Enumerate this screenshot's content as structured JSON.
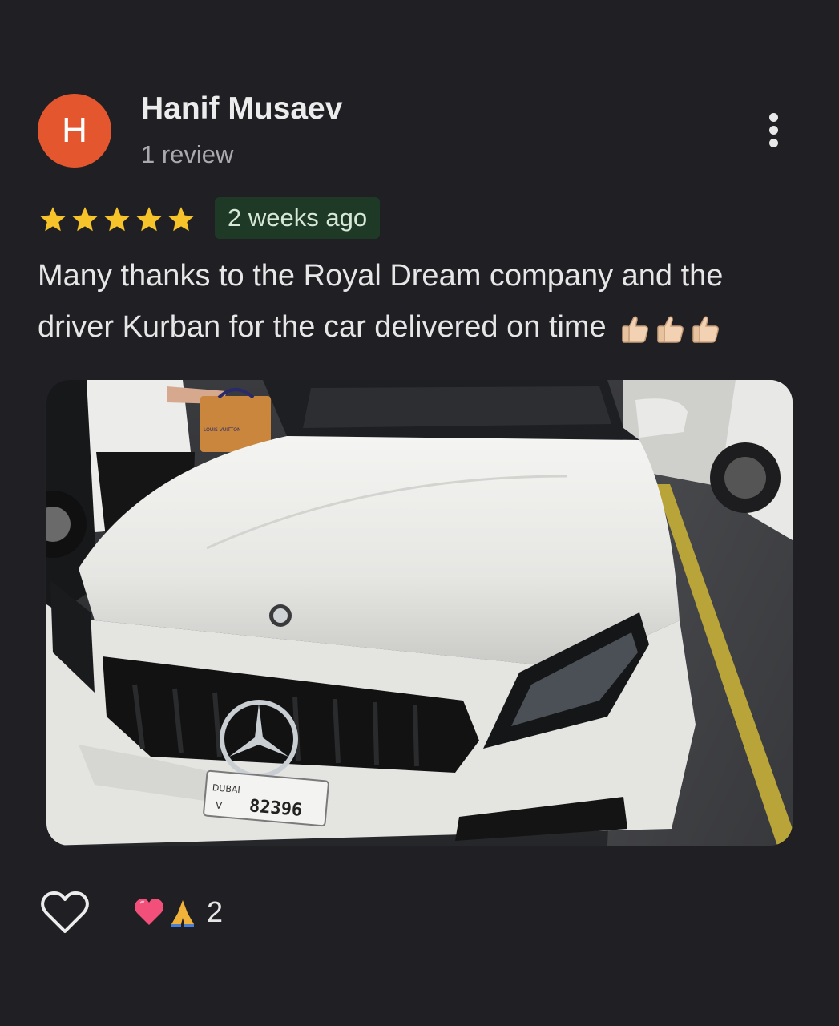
{
  "review": {
    "author_initial": "H",
    "author_name": "Hanif Musaev",
    "author_meta": "1 review",
    "rating": 5,
    "date": "2 weeks ago",
    "text": "Many thanks to the Royal Dream company and the driver Kurban for the car delivered on time",
    "text_emoji_icons": [
      "thumbs-up-icon",
      "thumbs-up-icon",
      "thumbs-up-icon"
    ],
    "photo": {
      "subject": "white-car-photo",
      "plate_number": "82396",
      "plate_letter": "V",
      "plate_city": "DUBAI",
      "bag_brand": "LOUIS VUITTON"
    }
  },
  "actions": {
    "like_icon": "heart-outline-icon",
    "reaction_icons": [
      "heart-emoji-icon",
      "praying-hands-emoji-icon"
    ],
    "reaction_count": "2"
  },
  "colors": {
    "background": "#1f1f24",
    "avatar": "#e4572e",
    "star": "#f6c32a",
    "date_badge_bg": "#1e3a26"
  }
}
